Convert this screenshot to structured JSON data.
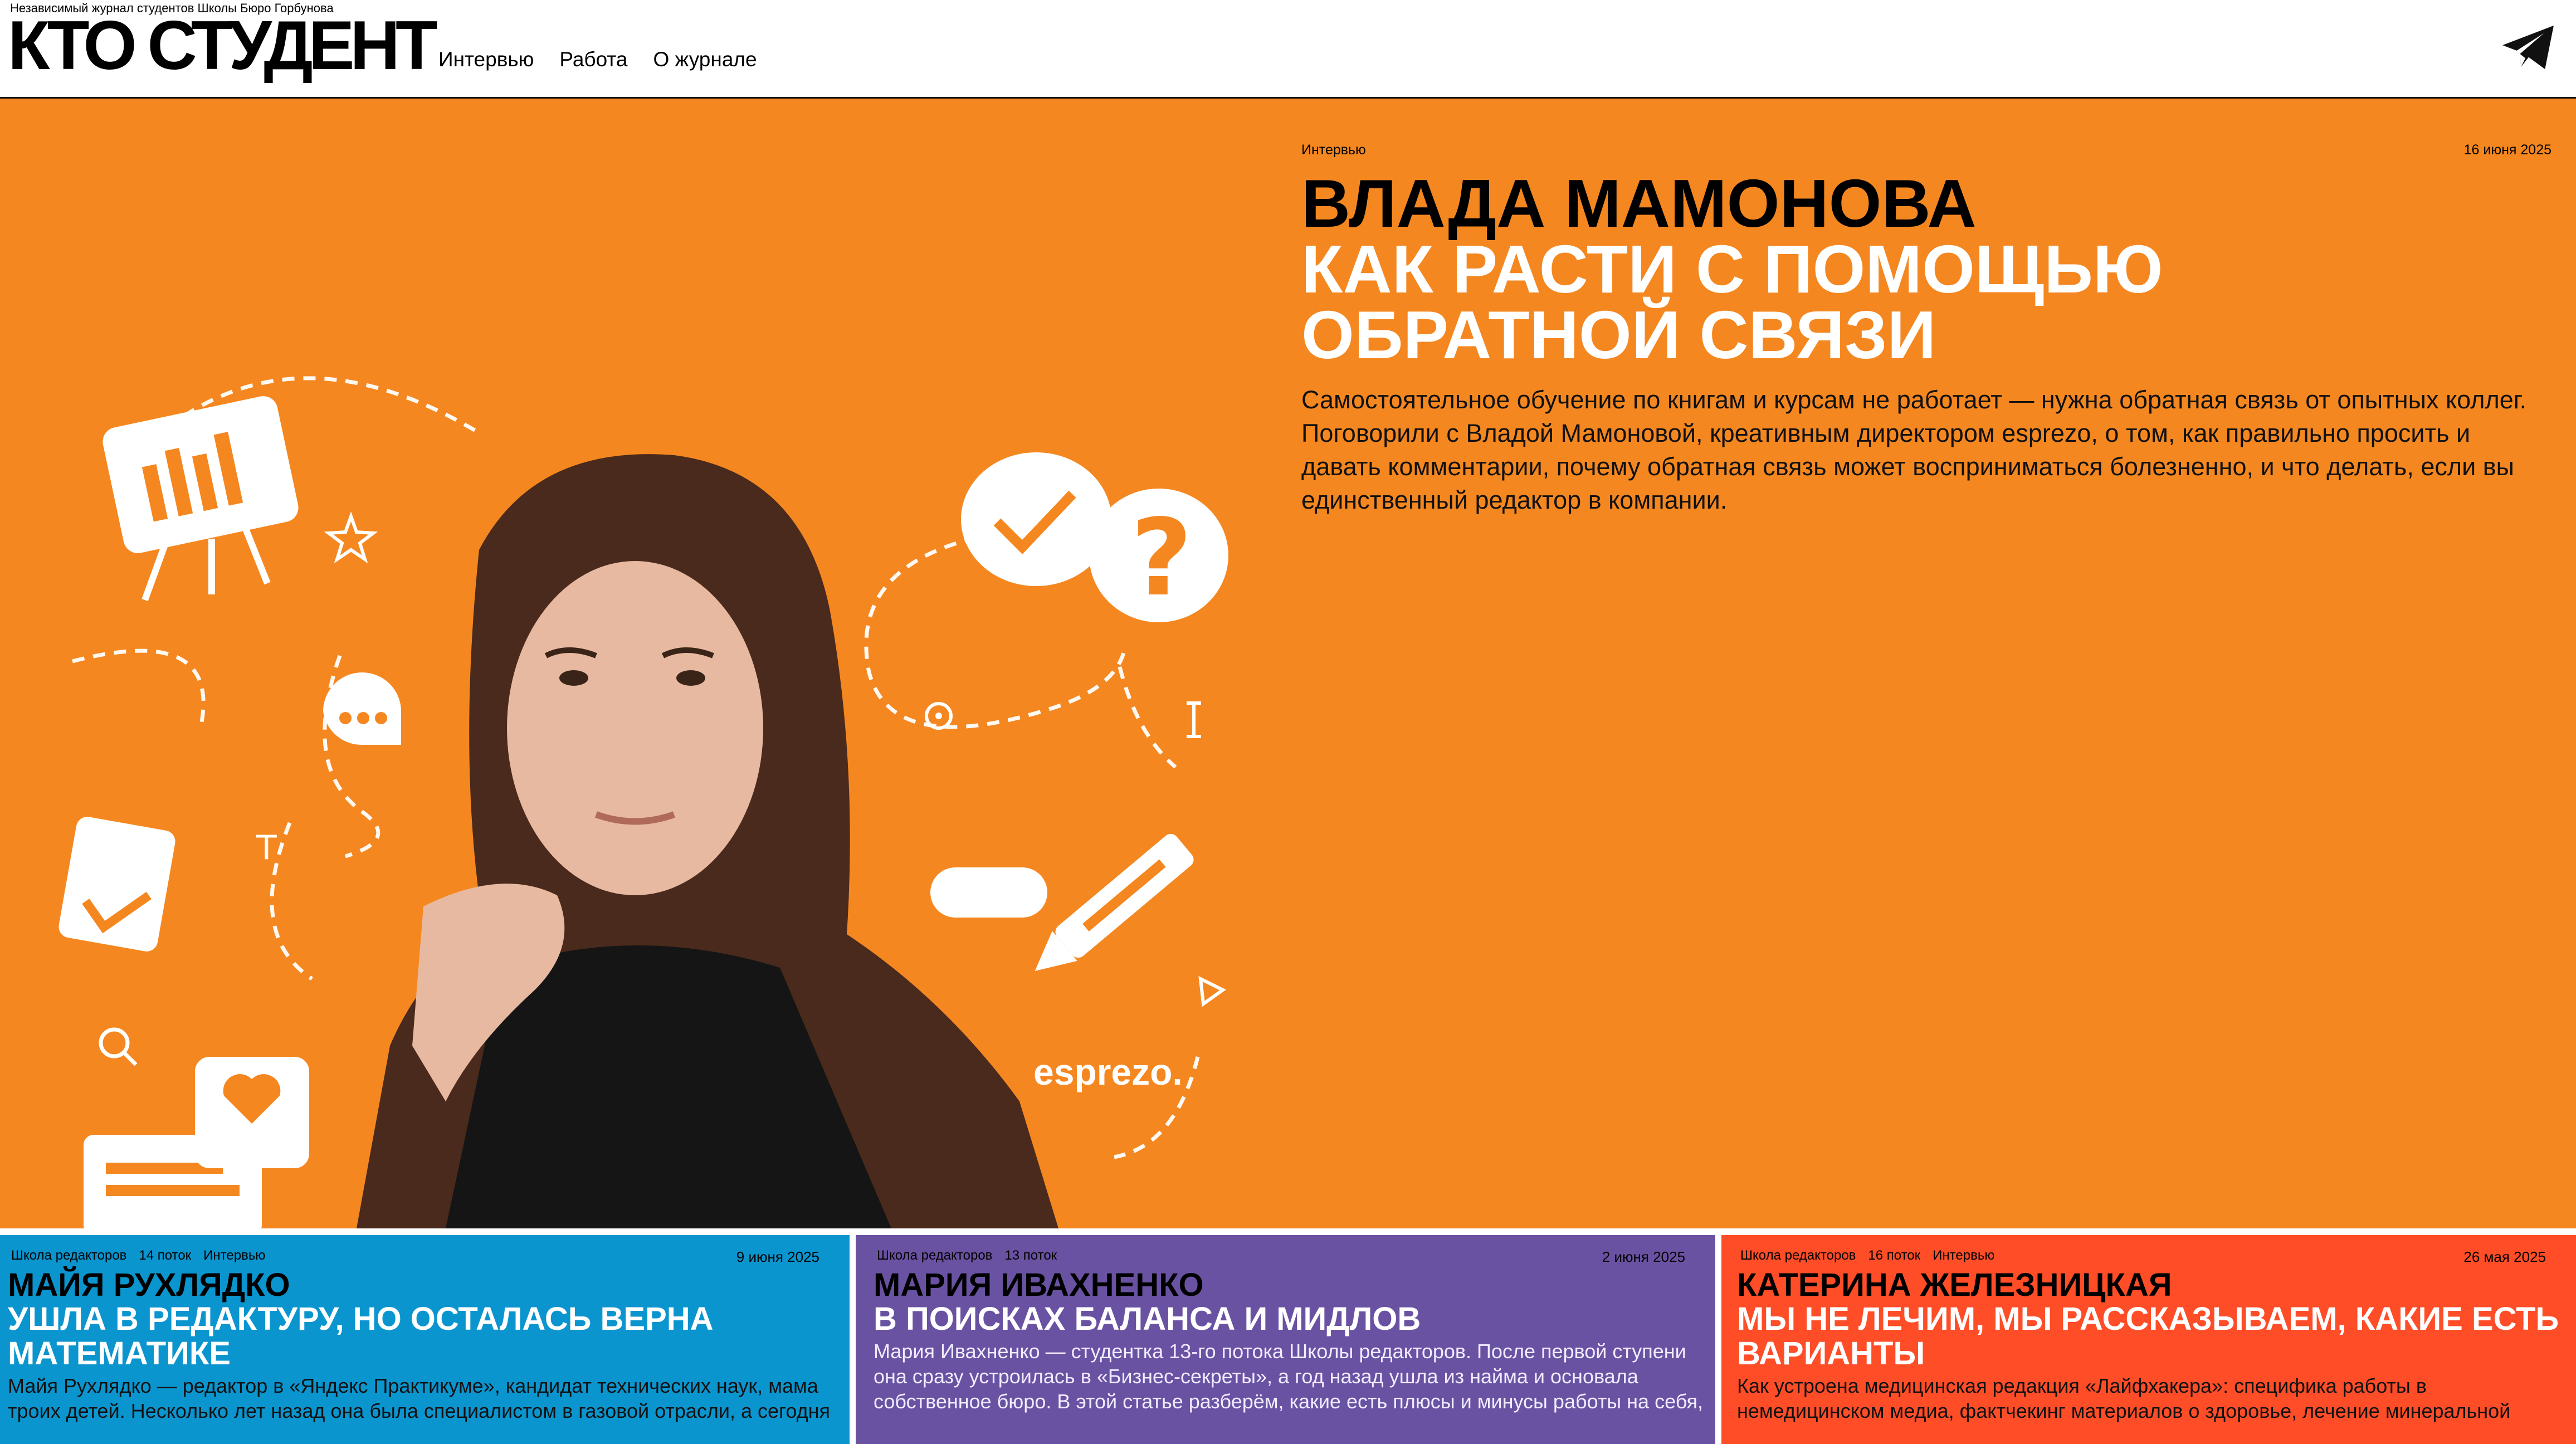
{
  "header": {
    "tagline": "Независимый журнал студентов Школы Бюро Горбунова",
    "logo": "КТО СТУДЕНТ",
    "nav": [
      "Интервью",
      "Работа",
      "О журнале"
    ],
    "send_icon": "telegram-plane-icon"
  },
  "hero": {
    "tag": "Интервью",
    "date": "16 июня 2025",
    "name": "Влада Мамонова",
    "subtitle": "Как расти с помощью обратной связи",
    "lead": "Самостоятельное обучение по книгам и курсам не работает — нужна обратная связь от опытных коллег. Поговорили с Владой Мамоновой, креативным директором esprezo, о том, как правильно просить и давать комментарии, почему обратная связь может восприниматься болезненно, и что делать, если вы единственный редактор в компании.",
    "image_brand": "esprezo.",
    "bg_color": "#f58720"
  },
  "cards": [
    {
      "tags": [
        "Школа редакторов",
        "14 поток",
        "Интервью"
      ],
      "date": "9 июня 2025",
      "name": "Майя Рухлядко",
      "title": "Ушла в редактуру, но осталась верна математике",
      "desc": "Майя Рухлядко — редактор в «Яндекс Практикуме», кандидат технических наук, мама троих детей. Несколько лет назад она была специалистом в газовой отрасли, а сегодня",
      "color": "#0b95cf"
    },
    {
      "tags": [
        "Школа редакторов",
        "13 поток"
      ],
      "date": "2 июня 2025",
      "name": "Мария Ивахненко",
      "title": "В поисках баланса и мидлов",
      "desc": "Мария Ивахненко — студентка 13-го потока Школы редакторов. После первой ступени она сразу устроилась в «Бизнес-секреты», а год назад ушла из найма и основала собственное бюро. В этой статье разберём, какие есть плюсы и минусы работы на себя,",
      "color": "#6a52a3"
    },
    {
      "tags": [
        "Школа редакторов",
        "16 поток",
        "Интервью"
      ],
      "date": "26 мая 2025",
      "name": "Катерина Железницкая",
      "title": "Мы не лечим, мы рассказываем, какие есть варианты",
      "desc": "Как устроена медицинская редакция «Лайфхакера»: специфика работы в немедицинском медиа, фактчекинг материалов о здоровье, лечение минеральной",
      "color": "#ff4d28"
    }
  ]
}
